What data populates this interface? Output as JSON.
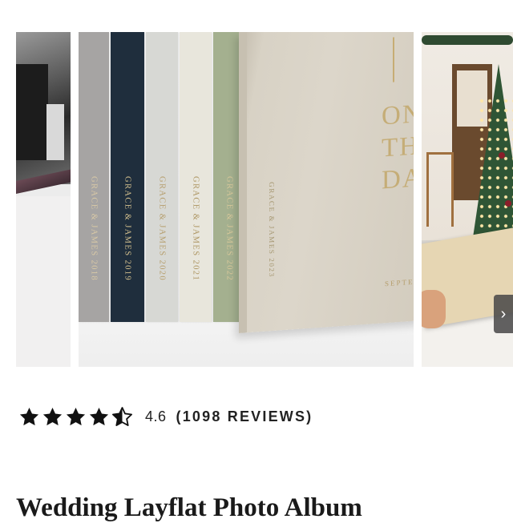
{
  "gallery": {
    "main_image": {
      "spines": [
        {
          "text": "GRACE & JAMES 2018",
          "color": "#a6a4a3"
        },
        {
          "text": "GRACE & JAMES 2019",
          "color": "#1f2e3d"
        },
        {
          "text": "GRACE & JAMES 2020",
          "color": "#d7d8d4"
        },
        {
          "text": "GRACE & JAMES 2021",
          "color": "#e8e6dc"
        },
        {
          "text": "GRACE & JAMES 2022",
          "color": "#a4b08f"
        }
      ],
      "featured_book": {
        "spine_text": "GRACE & JAMES 2023",
        "cover_title": "ONE\nTHE\nDA",
        "cover_date": "SEPTEM"
      }
    },
    "next_icon": "chevron-right-icon"
  },
  "rating": {
    "value": "4.6",
    "count_label": "(1098 REVIEWS)",
    "stars": 4.6,
    "star_color": "#111111"
  },
  "product": {
    "title": "Wedding Layflat Photo Album"
  }
}
